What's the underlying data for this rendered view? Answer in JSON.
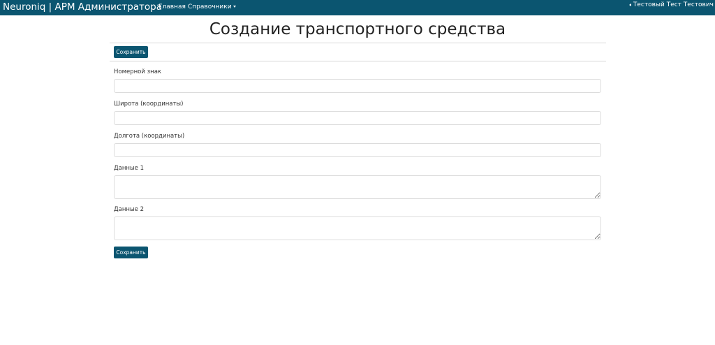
{
  "header": {
    "brand": "Neuroniq | АРМ Администратора",
    "nav": {
      "home_label": "Главная",
      "refs_label": "Справочники"
    },
    "user_name": "Тестовый Тест Тестович"
  },
  "page": {
    "title": "Создание транспортного средства",
    "save_label_top": "Сохранить",
    "save_label_bottom": "Сохранить"
  },
  "form": {
    "plate": {
      "label": "Номерной знак",
      "value": ""
    },
    "latitude": {
      "label": "Широта (координаты)",
      "value": ""
    },
    "longitude": {
      "label": "Долгота (координаты)",
      "value": ""
    },
    "data1": {
      "label": "Данные 1",
      "value": ""
    },
    "data2": {
      "label": "Данные 2",
      "value": ""
    }
  },
  "colors": {
    "navbar": "#0b5570",
    "button": "#0b5570"
  }
}
